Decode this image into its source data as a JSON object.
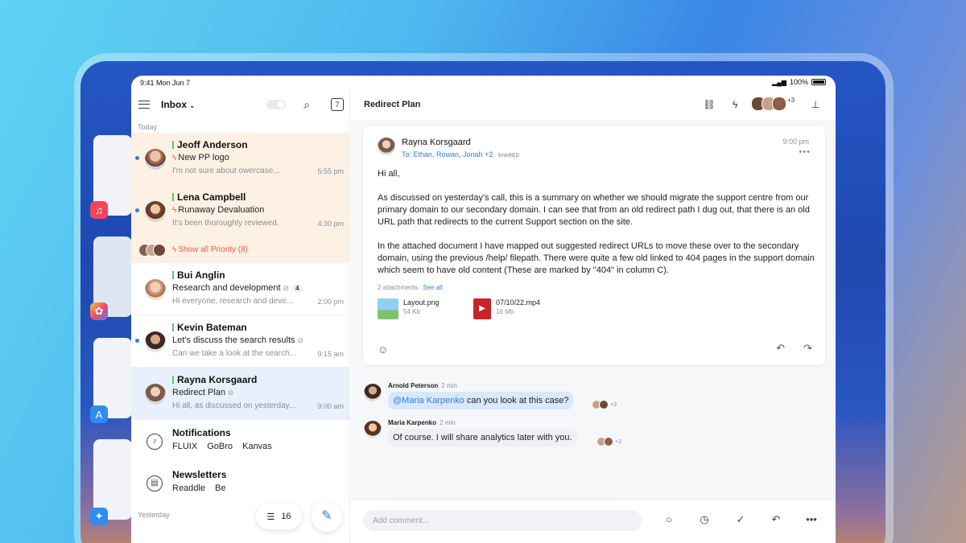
{
  "status": {
    "time": "9:41  Mon Jun 7",
    "battery": "100%"
  },
  "list": {
    "title": "Inbox",
    "today_label": "Today",
    "yesterday_label": "Yesterday",
    "show_priority": "Show all Priority (8)",
    "items": [
      {
        "sender": "Jeoff Anderson",
        "subject": "New PP logo",
        "preview": "I'm not sure about owercase...",
        "time": "5:55 pm"
      },
      {
        "sender": "Lena Campbell",
        "subject": "Runaway Devaluation",
        "preview": "It's been thoroughly reviewed.",
        "time": "4:30 pm"
      },
      {
        "sender": "Bui Anglin",
        "subject": "Research and development",
        "preview": "Hi everyone, research and deve...",
        "time": "2:00 pm",
        "count": "4"
      },
      {
        "sender": "Kevin Bateman",
        "subject": "Let's discuss the search results",
        "preview": "Can we take a look at the search...",
        "time": "9:15 am"
      },
      {
        "sender": "Rayna Korsgaard",
        "subject": "Redirect Plan",
        "preview": "Hi all, as discussed on yesterday...",
        "time": "9:00 am"
      }
    ],
    "groups": [
      {
        "title": "Notifications",
        "subs": [
          "FLUIX",
          "GoBro",
          "Kanvas"
        ]
      },
      {
        "title": "Newsletters",
        "subs": [
          "Readdle",
          "Be"
        ]
      }
    ],
    "filter_count": "16"
  },
  "detail": {
    "title": "Redirect Plan",
    "participants_extra": "+3",
    "email": {
      "from": "Rayna Korsgaard",
      "to": "To: Ethan, Rowan, Jonah +2",
      "shared": "SHARED",
      "time": "9:00 pm",
      "greeting": "Hi all,",
      "para1": "As discussed on yesterday's call, this is a summary on whether we should migrate the support centre from our primary domain to our secondary domain. I can see that from an old redirect path I dug out, that there is an old URL path that redirects to the current Support section on the site.",
      "para2": "In the attached document I have mapped out suggested redirect URLs to move these over to the secondary domain, using the previous /help/ filepath. There were quite a few old linked to 404 pages in the support domain which seem to have old content (These are marked by \"404\" in column C).",
      "attachments_label": "2 attachments",
      "see_all": "See all",
      "attachments": [
        {
          "name": "Layout.png",
          "size": "54 Kb"
        },
        {
          "name": "07/10/22.mp4",
          "size": "16 Mb"
        }
      ]
    },
    "comments": [
      {
        "name": "Arnold Peterson",
        "ago": "2 min",
        "mention": "@Maria Karpenko",
        "text": " can you look at this case?",
        "seen": "+3"
      },
      {
        "name": "Maria Karpenko",
        "ago": "2 min",
        "text": "Of course. I will share analytics later with you.",
        "seen": "+2"
      }
    ],
    "composer_placeholder": "Add comment..."
  },
  "colors": {
    "accent": "#2f7de1",
    "priority": "#ee5a48",
    "priority_bg": "#fdf1e4",
    "selected_bg": "#e8f0fb"
  }
}
